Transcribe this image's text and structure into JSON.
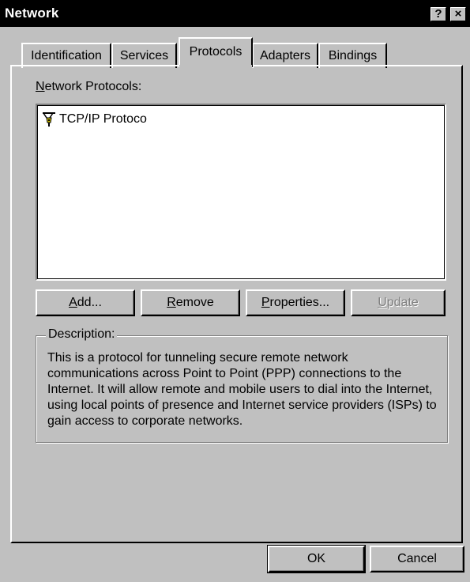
{
  "window": {
    "title": "Network",
    "help_label": "?",
    "close_label": "×"
  },
  "tabs": [
    {
      "label": "Identification",
      "active": false
    },
    {
      "label": "Services",
      "active": false
    },
    {
      "label": "Protocols",
      "active": true
    },
    {
      "label": "Adapters",
      "active": false
    },
    {
      "label": "Bindings",
      "active": false
    }
  ],
  "protocols": {
    "label_prefix": "N",
    "label_rest": "etwork Protocols:",
    "items": [
      {
        "label": "TCP/IP Protoco",
        "icon": "network-protocol-icon"
      }
    ]
  },
  "buttons": {
    "add_mn": "A",
    "add_rest": "dd...",
    "remove_mn": "R",
    "remove_rest": "emove",
    "properties_mn": "P",
    "properties_rest": "roperties...",
    "update_mn": "U",
    "update_rest": "pdate",
    "ok_label": "OK",
    "cancel_label": "Cancel"
  },
  "description": {
    "legend": "Description:",
    "text": "This is a protocol for tunneling secure remote network communications across Point to Point (PPP) connections to the Internet. It will allow remote and mobile users to dial into the Internet, using local points of presence and Internet service providers (ISPs) to gain access to corporate networks."
  },
  "colors": {
    "face": "#c0c0c0",
    "titlebar": "#000000",
    "shadow": "#808080",
    "highlight": "#ffffff"
  }
}
